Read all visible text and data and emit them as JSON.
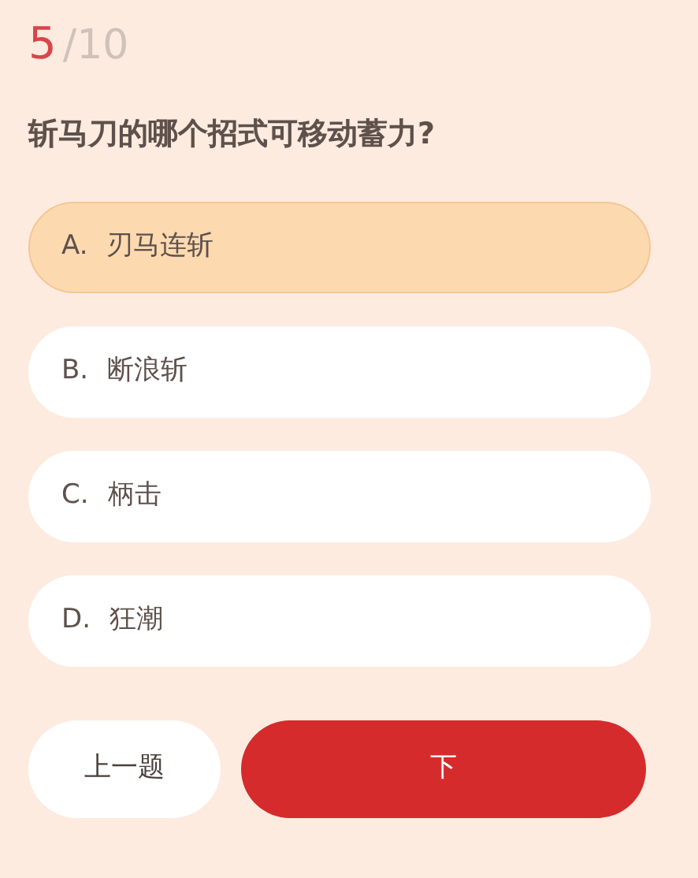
{
  "progress": {
    "current": "5",
    "total": "/10"
  },
  "question": "斩马刀的哪个招式可移动蓄力?",
  "options": [
    {
      "letter": "A.",
      "text": "刃马连斩",
      "selected": true
    },
    {
      "letter": "B.",
      "text": "断浪斩",
      "selected": false
    },
    {
      "letter": "C.",
      "text": "柄击",
      "selected": false
    },
    {
      "letter": "D.",
      "text": "狂潮",
      "selected": false
    }
  ],
  "buttons": {
    "prev": "上一题",
    "next": "下"
  }
}
